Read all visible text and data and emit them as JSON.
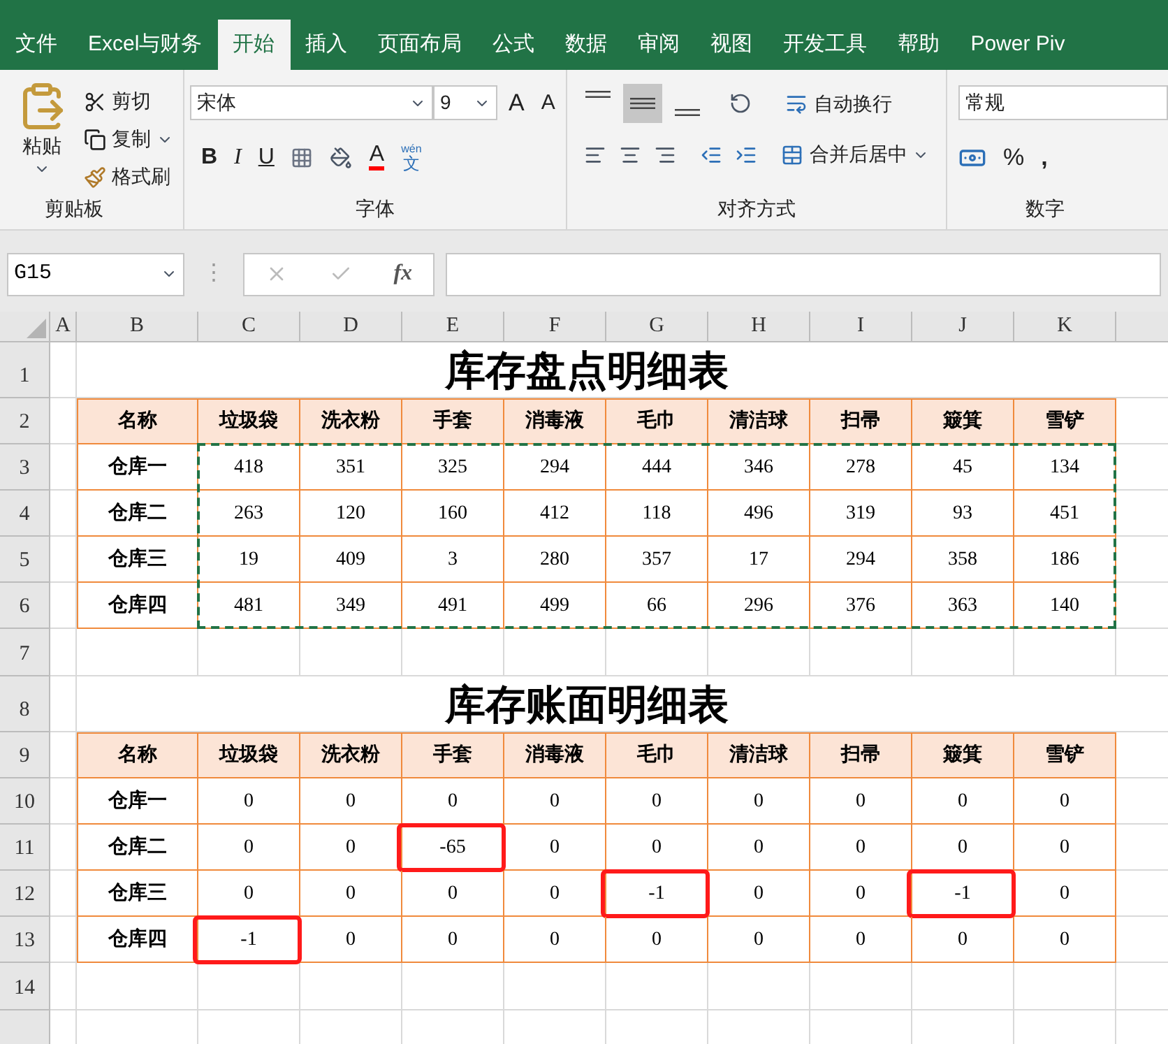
{
  "ribbon_tabs": [
    {
      "label": "文件",
      "selected": false
    },
    {
      "label": "Excel与财务",
      "selected": false
    },
    {
      "label": "开始",
      "selected": true
    },
    {
      "label": "插入",
      "selected": false
    },
    {
      "label": "页面布局",
      "selected": false
    },
    {
      "label": "公式",
      "selected": false
    },
    {
      "label": "数据",
      "selected": false
    },
    {
      "label": "审阅",
      "selected": false
    },
    {
      "label": "视图",
      "selected": false
    },
    {
      "label": "开发工具",
      "selected": false
    },
    {
      "label": "帮助",
      "selected": false
    },
    {
      "label": "Power Piv",
      "selected": false
    }
  ],
  "clipboard": {
    "paste": "粘贴",
    "cut": "剪切",
    "copy": "复制",
    "format_painter": "格式刷",
    "group_label": "剪贴板"
  },
  "font": {
    "name": "宋体",
    "size": "9",
    "grow": "A",
    "shrink": "A",
    "bold": "B",
    "italic": "I",
    "underline": "U",
    "color_letter": "A",
    "phonetic_top": "wén",
    "phonetic": "文",
    "group_label": "字体"
  },
  "alignment": {
    "vertical": [
      {
        "kind": "top",
        "selected": false
      },
      {
        "kind": "middle",
        "selected": true
      },
      {
        "kind": "bottom",
        "selected": false
      }
    ],
    "wrap": "自动换行",
    "merge": "合并后居中",
    "group_label": "对齐方式"
  },
  "number": {
    "format": "常规",
    "percent": "%",
    "comma": ",",
    "group_label": "数字"
  },
  "formula_bar": {
    "name_box": "G15",
    "separator": "⋮",
    "fx": "fx"
  },
  "column_letters": [
    "A",
    "B",
    "C",
    "D",
    "E",
    "F",
    "G",
    "H",
    "I",
    "J",
    "K"
  ],
  "row_numbers": [
    "1",
    "2",
    "3",
    "4",
    "5",
    "6",
    "7",
    "8",
    "9",
    "10",
    "11",
    "12",
    "13",
    "14"
  ],
  "tables": [
    {
      "title": "库存盘点明细表",
      "copy_selection": true,
      "header": [
        "名称",
        "垃圾袋",
        "洗衣粉",
        "手套",
        "消毒液",
        "毛巾",
        "清洁球",
        "扫帚",
        "簸箕",
        "雪铲"
      ],
      "rows": [
        {
          "name": "仓库一",
          "cells": [
            "418",
            "351",
            "325",
            "294",
            "444",
            "346",
            "278",
            "45",
            "134"
          ]
        },
        {
          "name": "仓库二",
          "cells": [
            "263",
            "120",
            "160",
            "412",
            "118",
            "496",
            "319",
            "93",
            "451"
          ]
        },
        {
          "name": "仓库三",
          "cells": [
            "19",
            "409",
            "3",
            "280",
            "357",
            "17",
            "294",
            "358",
            "186"
          ]
        },
        {
          "name": "仓库四",
          "cells": [
            "481",
            "349",
            "491",
            "499",
            "66",
            "296",
            "376",
            "363",
            "140"
          ]
        }
      ]
    },
    {
      "title": "库存账面明细表",
      "copy_selection": false,
      "header": [
        "名称",
        "垃圾袋",
        "洗衣粉",
        "手套",
        "消毒液",
        "毛巾",
        "清洁球",
        "扫帚",
        "簸箕",
        "雪铲"
      ],
      "rows": [
        {
          "name": "仓库一",
          "cells": [
            "0",
            "0",
            "0",
            "0",
            "0",
            "0",
            "0",
            "0",
            "0"
          ],
          "circled": [
            false,
            false,
            false,
            false,
            false,
            false,
            false,
            false,
            false
          ]
        },
        {
          "name": "仓库二",
          "cells": [
            "0",
            "0",
            "-65",
            "0",
            "0",
            "0",
            "0",
            "0",
            "0"
          ],
          "circled": [
            false,
            false,
            true,
            false,
            false,
            false,
            false,
            false,
            false
          ]
        },
        {
          "name": "仓库三",
          "cells": [
            "0",
            "0",
            "0",
            "0",
            "-1",
            "0",
            "0",
            "-1",
            "0"
          ],
          "circled": [
            false,
            false,
            false,
            false,
            true,
            false,
            false,
            true,
            false
          ]
        },
        {
          "name": "仓库四",
          "cells": [
            "-1",
            "0",
            "0",
            "0",
            "0",
            "0",
            "0",
            "0",
            "0"
          ],
          "circled": [
            true,
            false,
            false,
            false,
            false,
            false,
            false,
            false,
            false
          ]
        }
      ]
    }
  ]
}
